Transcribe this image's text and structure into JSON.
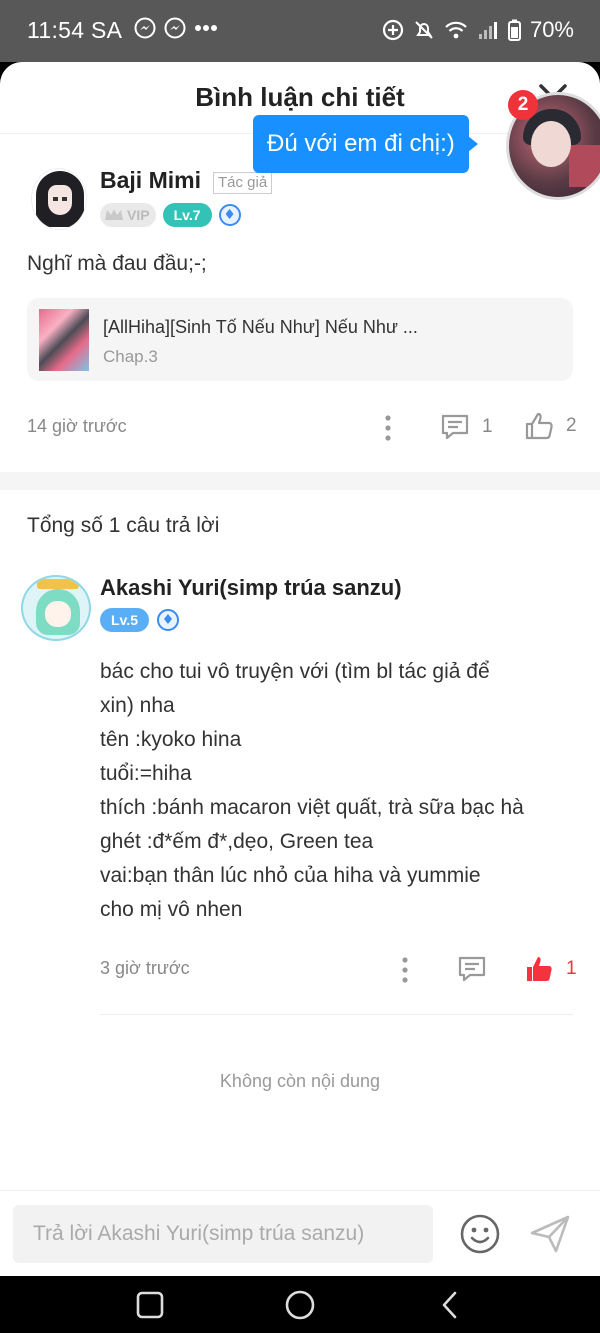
{
  "status_bar": {
    "time": "11:54 SA",
    "battery": "70%",
    "icons": [
      "messenger-icon",
      "messenger-icon",
      "more-dots-icon",
      "data-saver-icon",
      "mute-icon",
      "wifi-icon",
      "signal-icon",
      "battery-icon"
    ]
  },
  "header": {
    "title": "Bình luận chi tiết",
    "close_icon": "close-icon"
  },
  "floating": {
    "bubble_text": "Đú với em đi chị:)",
    "badge_count": "2"
  },
  "comment": {
    "author": "Baji Mimi",
    "author_tag": "Tác giả",
    "vip_label": "VIP",
    "level": "Lv.7",
    "text": "Nghĩ mà đau đầu;-;",
    "book": {
      "title": "[AllHiha][Sinh Tố Nếu Như] Nếu Như ...",
      "chapter": "Chap.3"
    },
    "time": "14 giờ trước",
    "reply_count": "1",
    "like_count": "2"
  },
  "replies_header": "Tổng số 1 câu trả lời",
  "reply": {
    "author": "Akashi Yuri(simp trúa sanzu)",
    "level": "Lv.5",
    "lines": [
      "bác cho tui vô truyện với (tìm bl tác giả để",
      "xin) nha",
      "tên :kyoko hina",
      "tuổi:=hiha",
      "thích :bánh macaron việt quất, trà sữa bạc hà",
      "ghét :đ*ếm đ*,dẹo, Green tea",
      "vai:bạn thân lúc nhỏ của hiha và yummie",
      "cho mị vô nhen"
    ],
    "time": "3 giờ trước",
    "like_count": "1",
    "accent_color": "#f5333f"
  },
  "end_text": "Không còn nội dung",
  "input": {
    "placeholder": "Trả lời Akashi Yuri(simp trúa sanzu)"
  }
}
